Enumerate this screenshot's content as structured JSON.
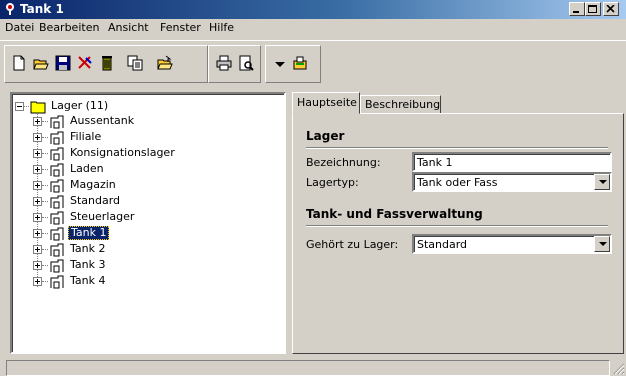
{
  "window": {
    "title": "Tank 1"
  },
  "menubar": {
    "items": [
      "Datei",
      "Bearbeiten",
      "Ansicht",
      "Fenster",
      "Hilfe"
    ]
  },
  "toolbar": {
    "buttons": [
      "new-icon",
      "open-icon",
      "save-icon",
      "edit-icon",
      "delete-icon",
      "copy-icon",
      "open-folder-icon",
      "print-icon",
      "print-preview-icon",
      "dropdown-arrow-icon",
      "stamp-icon"
    ]
  },
  "tree": {
    "root": {
      "label": "Lager (11)"
    },
    "children": [
      {
        "label": "Aussentank",
        "selected": false
      },
      {
        "label": "Filiale",
        "selected": false
      },
      {
        "label": "Konsignationslager",
        "selected": false
      },
      {
        "label": "Laden",
        "selected": false
      },
      {
        "label": "Magazin",
        "selected": false
      },
      {
        "label": "Standard",
        "selected": false
      },
      {
        "label": "Steuerlager",
        "selected": false
      },
      {
        "label": "Tank 1",
        "selected": true
      },
      {
        "label": "Tank 2",
        "selected": false
      },
      {
        "label": "Tank 3",
        "selected": false
      },
      {
        "label": "Tank 4",
        "selected": false
      }
    ]
  },
  "tabs": [
    {
      "label": "Hauptseite",
      "active": true
    },
    {
      "label": "Beschreibung",
      "active": false
    }
  ],
  "form": {
    "section_lager": "Lager",
    "bezeichnung_label": "Bezeichnung:",
    "bezeichnung_value": "Tank 1",
    "lagertyp_label": "Lagertyp:",
    "lagertyp_value": "Tank oder Fass",
    "section_tank": "Tank- und Fassverwaltung",
    "gehoert_label": "Gehört zu Lager:",
    "gehoert_value": "Standard"
  },
  "colors": {
    "titlebar_start": "#0a246a",
    "titlebar_end": "#a6caf0",
    "face": "#d4d0c8",
    "selection": "#0a246a",
    "folder": "#ffff00"
  }
}
